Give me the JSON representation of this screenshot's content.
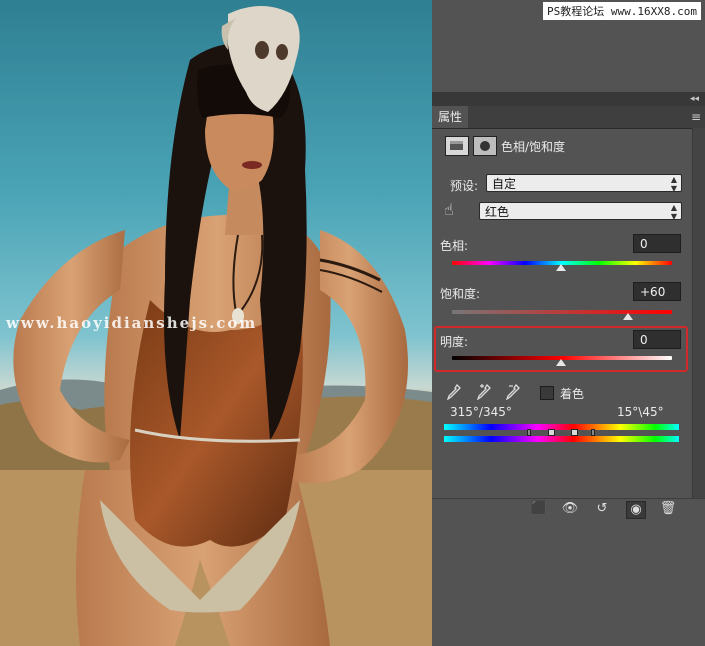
{
  "watermark_url": "PS教程论坛 www.16XX8.com",
  "photo_watermark": "www.haoyidianshejs.com",
  "panel": {
    "tab_label": "属性",
    "adjustment_title": "色相/饱和度",
    "preset": {
      "label": "预设:",
      "value": "自定"
    },
    "channel": {
      "value": "红色"
    },
    "hue": {
      "label": "色相:",
      "value": "0"
    },
    "saturation": {
      "label": "饱和度:",
      "value": "+60"
    },
    "lightness": {
      "label": "明度:",
      "value": "0"
    },
    "colorize": {
      "label": "着色",
      "checked": false
    },
    "range": {
      "left": "315°/345°",
      "right": "15°\\45°"
    }
  },
  "colors": {
    "panel_bg": "#535353",
    "highlight": "#d02a2a",
    "field_bg": "#2f2f2f"
  },
  "icons": [
    "layers-icon",
    "mask-icon",
    "hand-target-icon",
    "eyedropper-icon",
    "eyedropper-plus-icon",
    "eyedropper-minus-icon",
    "clip-to-layer-icon",
    "view-previous-icon",
    "reset-icon",
    "visibility-eye-icon",
    "trash-icon"
  ]
}
